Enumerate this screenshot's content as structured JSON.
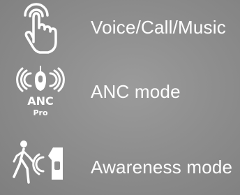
{
  "modes": [
    {
      "icon": "touch-finger-icon",
      "label": "Voice/Call/Music"
    },
    {
      "icon": "anc-pro-icon",
      "label": "ANC mode",
      "badge_main": "ANC",
      "badge_sub": "Pro"
    },
    {
      "icon": "awareness-icon",
      "label": "Awareness mode"
    }
  ],
  "colors": {
    "background": "#8e8e8e",
    "foreground": "#ffffff"
  }
}
